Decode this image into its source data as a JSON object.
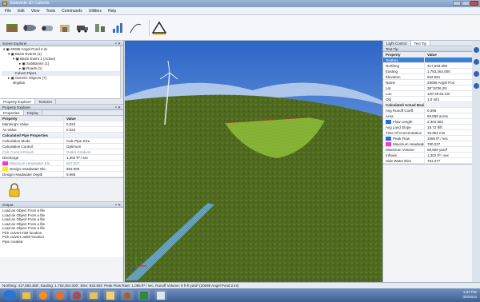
{
  "window": {
    "title": "Statewide 3D Culverts"
  },
  "menu": [
    "File",
    "Edit",
    "View",
    "Tools",
    "Commands",
    "Utilities",
    "Help"
  ],
  "scene_explorer": {
    "title": "Scene Explorer",
    "nodes": [
      "20089 Angel Pond 2.ini",
      "Basin Events (1)",
      "Basin Event 1 (Active)",
      "SubBasins (1)",
      "Roads (1)",
      "Culvert Pipe1",
      "Generic Objects (7)",
      "skyplan"
    ]
  },
  "property_explorer": {
    "tabs": [
      "Property Explorer",
      "Textures"
    ],
    "title": "Property Explorer",
    "subtabs": [
      "Properties",
      "Display"
    ],
    "columns": [
      "Property",
      "Value"
    ],
    "rows": [
      {
        "k": "Manning's Value",
        "v": "0.024"
      },
      {
        "k": "As Value",
        "v": "0.024"
      },
      {
        "k": "Calculated Pipe Properties",
        "v": "",
        "section": true
      },
      {
        "k": "Calculation Mode",
        "v": "Calc Pipe Size"
      },
      {
        "k": "Calculation Control",
        "v": "Optimum"
      },
      {
        "k": "Calc Control Result",
        "v": "Outlet Gradient",
        "dim": true
      },
      {
        "k": "Discharge",
        "v": "1,302 ft³ / sec"
      },
      {
        "k": "Maximum Headwater Ele.",
        "v": "887.307",
        "swatch": "#ff33cc",
        "dim": true
      },
      {
        "k": "Design Headwater Ele.",
        "v": "882.900",
        "swatch": "#ffee00"
      },
      {
        "k": "Design Headwater Depth",
        "v": "9.965"
      }
    ]
  },
  "output": {
    "title": "Output",
    "lines": [
      "Load an Object From a file",
      "Load an Object From a file",
      "Load an Object From a file",
      "Load an Object From a file",
      "Load an Object From a file",
      "Pick culvert inlet location",
      "Pick culvert outlet location",
      "Pipe created"
    ]
  },
  "right_panel": {
    "tabs": [
      "Light Control",
      "Text Tip"
    ],
    "title": "Text Tip",
    "columns": [
      "Property",
      "Value"
    ],
    "rows": [
      {
        "k": "Textbox",
        "v": "",
        "selected": true
      },
      {
        "k": "Northing",
        "v": "417,593.368"
      },
      {
        "k": "Easting",
        "v": "1,783,364.000"
      },
      {
        "k": "Elevation",
        "v": "832.591"
      },
      {
        "k": "Name",
        "v": "20089 Angel Pon"
      },
      {
        "k": "Lat",
        "v": "38°18'36.2N"
      },
      {
        "k": "Lon",
        "v": "120°45'26.1W"
      },
      {
        "k": "Obj",
        "v": "1.0 Info"
      },
      {
        "k": "Calculated Actual Basin 1",
        "v": "",
        "section": true
      },
      {
        "k": "Avg Runoff Coeff.",
        "v": "0.396"
      },
      {
        "k": "Area",
        "v": "68.858 acres"
      },
      {
        "k": "Flow Length",
        "v": "2,304.882",
        "swatch": "#1e6cff"
      },
      {
        "k": "Avg Land Slope",
        "v": "18.72 ft/ft"
      },
      {
        "k": "Time Of Concentration",
        "v": "19.953 min"
      },
      {
        "k": "Peak Flow",
        "v": "1086 ft³ / sec",
        "swatch": "#1e6cff"
      },
      {
        "k": "Maximum Headwater",
        "v": "780.037",
        "swatch": "#ff33cc"
      },
      {
        "k": "Maximum Volume",
        "v": "68,606 yard³"
      },
      {
        "k": "Inflows",
        "v": "1,302 ft³ / sec"
      },
      {
        "k": "Side Water Elev",
        "v": "781.077"
      }
    ]
  },
  "status": {
    "text": "Northing: 417,593.368', Easting: 1,783,364.000', Elev: 832.591'   Peak Flow Rate: 1,086 ft³ / sec, Runoff Volume: 8 ft-ft yard³ (20089 Angel Pond 2.ini)"
  },
  "taskbar": {
    "icons": [
      "start-orb-icon",
      "explorer-icon",
      "media-icon",
      "firefox-icon",
      "chrome-icon",
      "folder-icon",
      "paint-icon",
      "culvert-icon",
      "chart-icon",
      "notepad-icon"
    ],
    "time": "1:32 PM",
    "date": "3/3/2014"
  }
}
